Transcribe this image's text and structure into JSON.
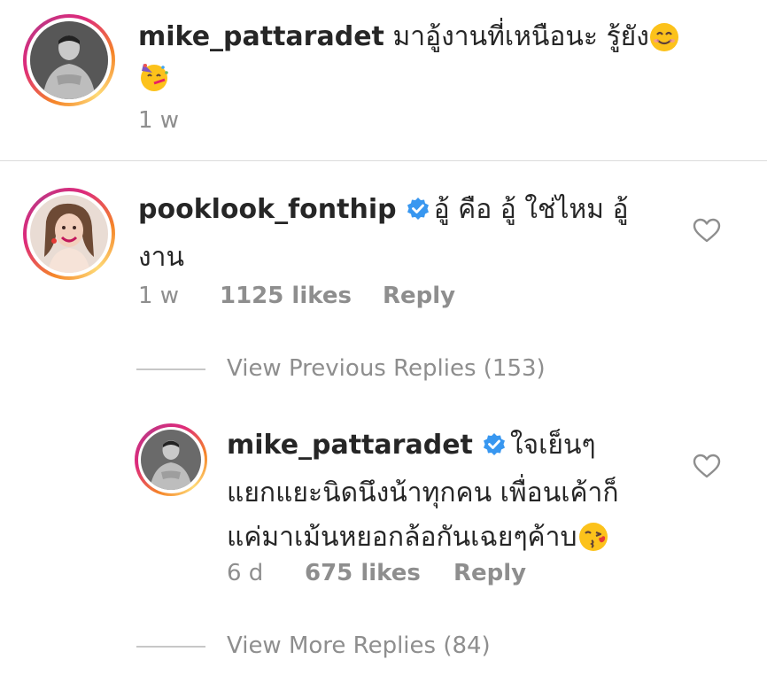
{
  "comments": [
    {
      "username": "mike_pattaradet",
      "text_line1": "มาอู้งานที่เหนือนะ รู้ยัง",
      "emoji1": "smiling-face-icon",
      "emoji2": "party-face-icon",
      "time": "1 w"
    },
    {
      "username": "pooklook_fonthip",
      "text_line1": "อู้ คือ อู้ ใช่ไหม อู้",
      "text_line2": "งาน",
      "time": "1 w",
      "likes": "1125 likes",
      "reply": "Reply",
      "view_replies": "View Previous Replies (153)"
    },
    {
      "username": "mike_pattaradet",
      "text_line1": "ใจเย็นๆ",
      "text_line2": "แยกแยะนิดนึงน้าทุกคน เพื่อนเค้าก็",
      "text_line3": "แค่มาเม้นหยอกล้อกันเฉยๆค้าบ",
      "emoji": "kissing-face-icon",
      "time": "6 d",
      "likes": "675 likes",
      "reply": "Reply",
      "view_replies": "View More Replies (84)"
    }
  ],
  "colors": {
    "verified": "#3897f0",
    "muted": "#8e8e8e",
    "text": "#262626"
  }
}
